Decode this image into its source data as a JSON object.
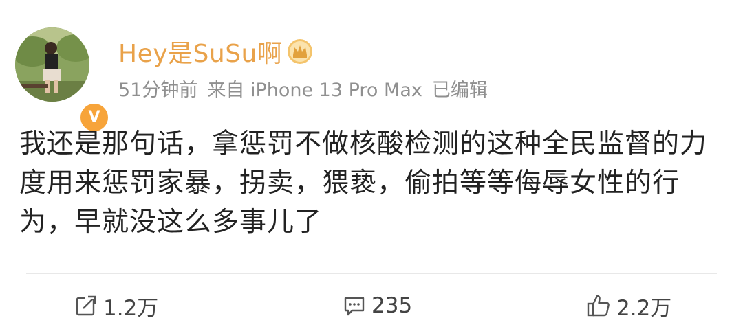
{
  "user": {
    "name": "Hey是SuSu啊",
    "verified_badge": "V",
    "badge_icon": "crown-icon"
  },
  "meta": {
    "time": "51分钟前",
    "source": "来自 iPhone 13 Pro Max",
    "edited": "已编辑"
  },
  "post": {
    "text": "我还是那句话，拿惩罚不做核酸检测的这种全民监督的力度用来惩罚家暴，拐卖，猥亵，偷拍等等侮辱女性的行为，早就没这么多事儿了"
  },
  "actions": {
    "repost": {
      "icon": "share-icon",
      "count": "1.2万"
    },
    "comment": {
      "icon": "comment-icon",
      "count": "235"
    },
    "like": {
      "icon": "thumbs-up-icon",
      "count": "2.2万"
    }
  },
  "colors": {
    "username": "#e9a24a",
    "meta": "#8f8f8f",
    "body_text": "#222222",
    "badge": "#f7a43a"
  }
}
